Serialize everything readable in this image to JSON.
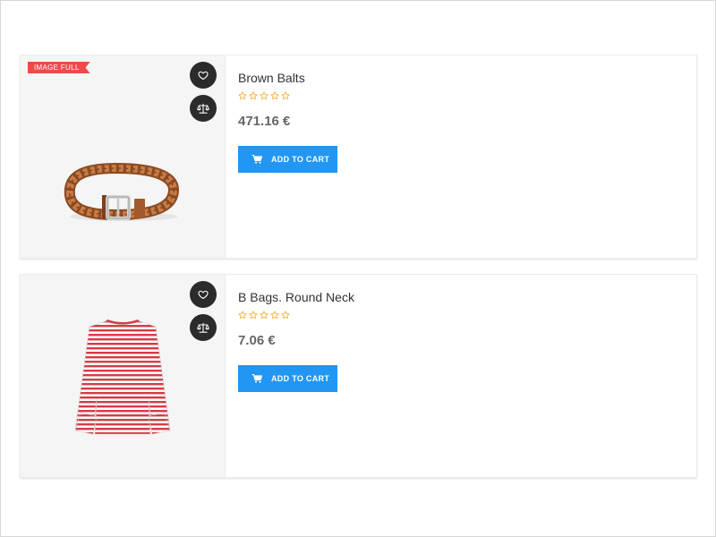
{
  "products": [
    {
      "badge": "IMAGE FULL",
      "name": "Brown Balts",
      "rating": 0,
      "rating_max": 5,
      "price": "471.16 €",
      "add_to_cart_label": "ADD TO CART",
      "image_icon": "braided-belt-image"
    },
    {
      "name": "B Bags. Round Neck",
      "rating": 0,
      "rating_max": 5,
      "price": "7.06 €",
      "add_to_cart_label": "ADD TO CART",
      "image_icon": "striped-top-image"
    }
  ],
  "icons": {
    "wishlist": "heart-icon",
    "compare": "scale-icon",
    "cart": "cart-icon",
    "rating": "star-outline-icon"
  },
  "colors": {
    "accent": "#2196f3",
    "badge": "#ef4a4a",
    "star": "#f5a623",
    "round_button": "#2b2b2b"
  }
}
